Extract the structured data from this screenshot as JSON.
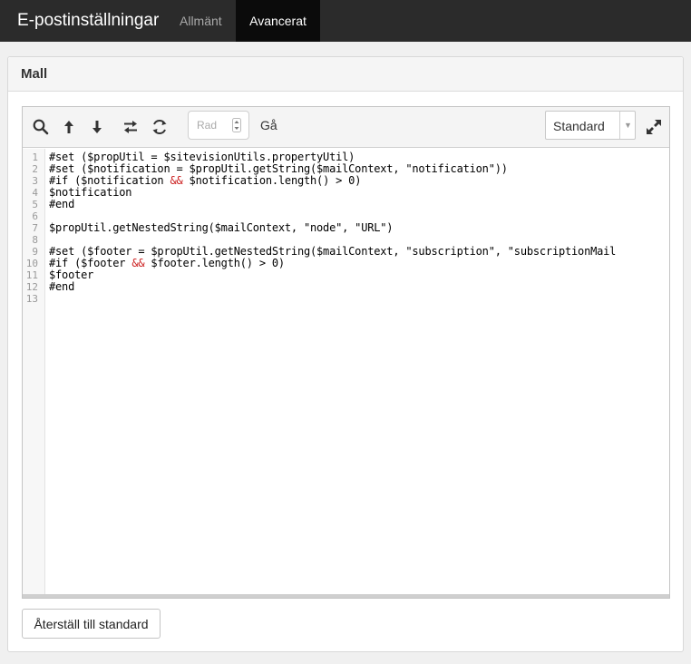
{
  "app": {
    "title": "E-postinställningar"
  },
  "nav": {
    "tabs": [
      {
        "label": "Allmänt"
      },
      {
        "label": "Avancerat"
      }
    ]
  },
  "panel": {
    "title": "Mall"
  },
  "toolbar": {
    "icons": [
      "search-icon",
      "arrow-up-icon",
      "arrow-down-icon",
      "swap-icon",
      "refresh-icon"
    ],
    "line_input_placeholder": "Rad",
    "go_label": "Gå",
    "theme_select_value": "Standard",
    "expand_icon": "expand-icon"
  },
  "editor": {
    "line_numbers": [
      "1",
      "2",
      "3",
      "4",
      "5",
      "6",
      "7",
      "8",
      "9",
      "10",
      "11",
      "12",
      "13"
    ],
    "lines": [
      [
        "#set ($propUtil = $sitevisionUtils.propertyUtil)"
      ],
      [
        "#set ($notification = $propUtil.getString($mailContext, \"notification\"))"
      ],
      [
        "#if ($notification ",
        "&&",
        " $notification.length() > 0)"
      ],
      [
        "$notification"
      ],
      [
        "#end"
      ],
      [
        ""
      ],
      [
        "$propUtil.getNestedString($mailContext, \"node\", \"URL\")"
      ],
      [
        ""
      ],
      [
        "#set ($footer = $propUtil.getNestedString($mailContext, \"subscription\", \"subscriptionMail"
      ],
      [
        "#if ($footer ",
        "&&",
        " $footer.length() > 0)"
      ],
      [
        "$footer"
      ],
      [
        "#end"
      ],
      [
        ""
      ]
    ]
  },
  "actions": {
    "reset_label": "Återställ till standard"
  }
}
